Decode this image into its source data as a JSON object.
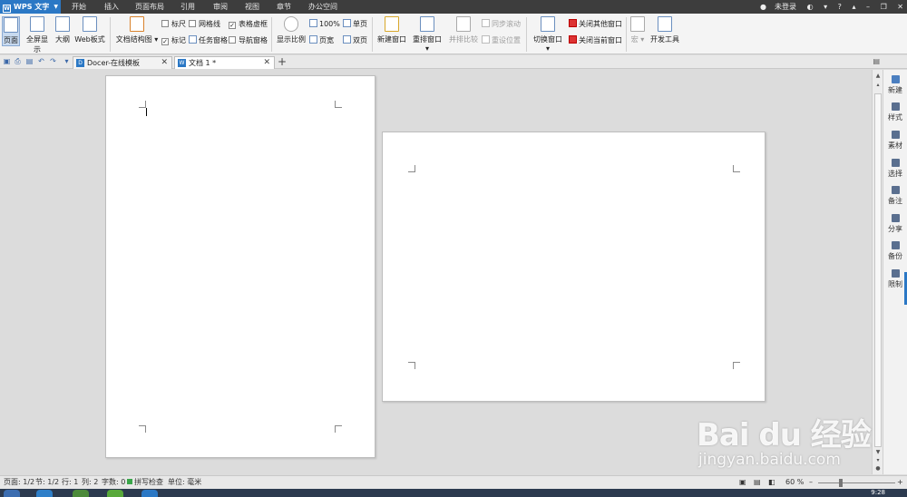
{
  "app": {
    "name": "WPS 文字"
  },
  "menu": [
    "开始",
    "插入",
    "页面布局",
    "引用",
    "审阅",
    "视图",
    "章节",
    "办公空间"
  ],
  "window": {
    "login": "未登录",
    "help": "?"
  },
  "ribbon": {
    "page_view": "页面",
    "full_screen": "全屏显示",
    "outline": "大纲",
    "web_layout": "Web板式",
    "doc_structure": "文档结构图",
    "ruler": "标尺",
    "gridlines": "网格线",
    "table_gridlines": "表格虚框",
    "marks": "标记",
    "task_pane": "任务窗格",
    "nav_pane": "导航窗格",
    "zoom": "显示比例",
    "zoom_100": "100%",
    "page_width": "页宽",
    "single_page": "单页",
    "two_pages": "双页",
    "new_window": "新建窗口",
    "arrange": "重排窗口",
    "side_by_side": "并排比较",
    "sync_scroll": "同步滚动",
    "reset_position": "重设位置",
    "switch_window": "切换窗口",
    "close_others": "关闭其他窗口",
    "close_current": "关闭当前窗口",
    "macro": "宏",
    "dev_tools": "开发工具"
  },
  "tabs": [
    {
      "title": "Docer-在线模板"
    },
    {
      "title": "文档 1 *"
    }
  ],
  "taskpane": [
    "新建",
    "样式",
    "素材",
    "选择",
    "备注",
    "分享",
    "备份",
    "限制"
  ],
  "status": {
    "page": "页面: 1/2",
    "section": "节: 1/2",
    "row": "行: 1",
    "col": "列: 2",
    "word_count": "字数: 0",
    "spell_check": "拼写检查",
    "unit": "单位: 毫米",
    "zoom": "60 %"
  },
  "taskbar": {
    "clock": "9:28"
  },
  "watermark": {
    "brand": "Bai du 经验",
    "url": "jingyan.baidu.com"
  },
  "colors": {
    "accent": "#2b78c5",
    "menubar": "#3d3d3d",
    "canvas": "#dcdcdc"
  }
}
